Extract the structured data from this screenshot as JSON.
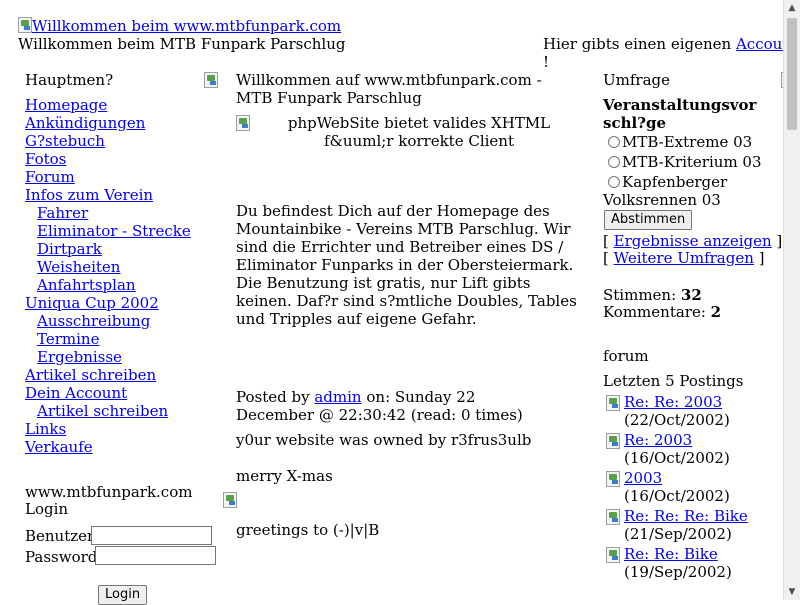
{
  "header": {
    "logo_alt": "Willkommen beim www.mtbfunpark.com",
    "welcome": "Willkommen beim MTB Funpark Parschlug",
    "account_prefix": "Hier gibts einen eigenen",
    "account_link": "Account",
    "account_suffix": "!"
  },
  "left": {
    "menu_title": "Hauptmen?",
    "items": [
      {
        "label": "Homepage",
        "level": 0
      },
      {
        "label": "Ankündigungen",
        "level": 0
      },
      {
        "label": "G?stebuch",
        "level": 0
      },
      {
        "label": "Fotos",
        "level": 0
      },
      {
        "label": "Forum",
        "level": 0
      },
      {
        "label": "Infos zum Verein",
        "level": 0
      },
      {
        "label": "Fahrer",
        "level": 1
      },
      {
        "label": "Eliminator - Strecke",
        "level": 1
      },
      {
        "label": "Dirtpark",
        "level": 1
      },
      {
        "label": "Weisheiten",
        "level": 1
      },
      {
        "label": "Anfahrtsplan",
        "level": 1
      },
      {
        "label": "Uniqua Cup 2002",
        "level": 0
      },
      {
        "label": "Ausschreibung",
        "level": 1
      },
      {
        "label": "Termine",
        "level": 1
      },
      {
        "label": "Ergebnisse",
        "level": 1
      },
      {
        "label": "Artikel schreiben",
        "level": 0
      },
      {
        "label": "Dein Account",
        "level": 0
      },
      {
        "label": "Artikel schreiben",
        "level": 1
      },
      {
        "label": "Links",
        "level": 0
      },
      {
        "label": "Verkaufe",
        "level": 0
      }
    ],
    "login_site": "www.mtbfunpark.com",
    "login_title": "Login",
    "user_label": "Benutzer:",
    "pass_label": "Password:",
    "user_value": "",
    "pass_value": "",
    "login_button": "Login"
  },
  "center": {
    "title": "Willkommen auf www.mtbfunpark.com - MTB Funpark Parschlug",
    "img_alt": "phpWebSite bietet valides XHTML f&uuml;r korrekte Client",
    "intro": "Du befindest Dich auf der Homepage des Mountainbike - Vereins MTB Parschlug. Wir sind die Errichter und Betreiber eines DS / Eliminator Funparks in der Obersteiermark. Die Benutzung ist gratis, nur Lift gibts keinen. Daf?r sind s?mtliche Doubles, Tables und Tripples auf eigene Gefahr.",
    "posted_prefix": "Posted by",
    "posted_author": "admin",
    "posted_suffix": "on: Sunday 22 December @ 22:30:42 (read: 0 times)",
    "line1": "y0ur website was owned by r3frus3ulb",
    "line2": "merry X-mas",
    "line3": "greetings to (-)|v|B"
  },
  "right": {
    "poll_title": "Umfrage",
    "poll_question": "Veranstaltungsvorschl?ge",
    "options": [
      "MTB-Extreme 03",
      "MTB-Kriterium 03",
      "Kapfenberger Volksrennen 03"
    ],
    "vote_button": "Abstimmen",
    "results_link": "Ergebnisse anzeigen",
    "more_link": "Weitere Umfragen",
    "votes_label": "Stimmen:",
    "votes_value": "32",
    "comments_label": "Kommentare:",
    "comments_value": "2",
    "forum_title": "forum",
    "forum_sub": "Letzten 5 Postings",
    "posts": [
      {
        "title": "Re: Re: 2003",
        "date": "(22/Oct/2002)"
      },
      {
        "title": "Re: 2003",
        "date": "(16/Oct/2002)"
      },
      {
        "title": "2003",
        "date": "(16/Oct/2002)"
      },
      {
        "title": "Re: Re: Re: Bike",
        "date": "(21/Sep/2002)"
      },
      {
        "title": "Re: Re: Bike",
        "date": "(19/Sep/2002)"
      }
    ]
  }
}
